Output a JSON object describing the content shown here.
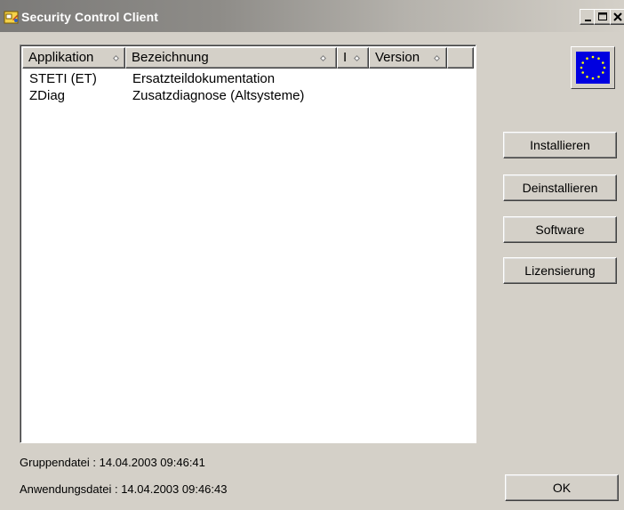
{
  "window": {
    "title": "Security Control Client"
  },
  "list": {
    "columns": [
      {
        "label": "Applikation",
        "sort_icon": "sort-diamond-icon"
      },
      {
        "label": "Bezeichnung",
        "sort_icon": "sort-diamond-icon"
      },
      {
        "label": "I",
        "sort_icon": "sort-diamond-icon"
      },
      {
        "label": "Version",
        "sort_icon": "sort-diamond-icon"
      },
      {
        "label": ""
      }
    ],
    "rows": [
      {
        "app": "STETI (ET)",
        "description": "Ersatzteildokumentation",
        "i": "",
        "version": ""
      },
      {
        "app": "ZDiag",
        "description": "Zusatzdiagnose (Altsysteme)",
        "i": "",
        "version": ""
      }
    ]
  },
  "buttons": {
    "install": "Installieren",
    "uninstall": "Deinstallieren",
    "software": "Software",
    "licensing": "Lizensierung",
    "ok": "OK"
  },
  "status": {
    "group_file": "Gruppendatei : 14.04.2003  09:46:41",
    "application_file": "Anwendungsdatei : 14.04.2003  09:46:43"
  },
  "colors": {
    "eu_blue": "#0000e0",
    "eu_star": "#ffff00"
  },
  "icons": {
    "app_icon": "lock-key-icon",
    "logo": "eu-flag-icon"
  }
}
